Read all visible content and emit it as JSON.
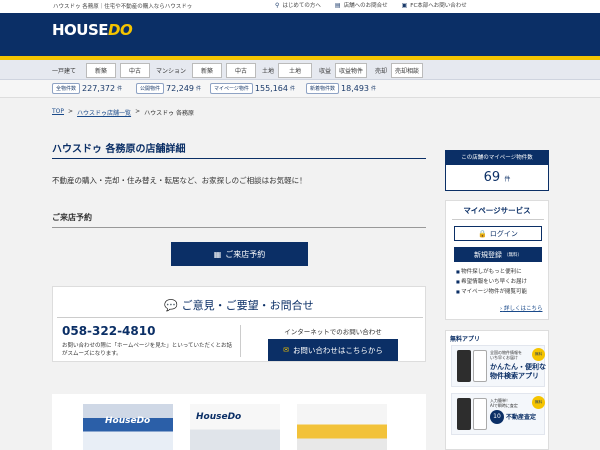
{
  "topbar": {
    "tagline": "ハウスドゥ 各務原｜住宅や不動産の購入ならハウスドゥ",
    "links": [
      {
        "icon": "map-pin-icon",
        "label": "はじめての方へ"
      },
      {
        "icon": "document-icon",
        "label": "店舗へのお問合せ"
      },
      {
        "icon": "building-icon",
        "label": "FC本部へお問い合わせ"
      }
    ]
  },
  "header": {
    "logo_house": "HOUSE",
    "logo_do": "DO"
  },
  "nav": {
    "groups": [
      {
        "category": "一戸建て",
        "buttons": [
          "新築",
          "中古"
        ]
      },
      {
        "category": "マンション",
        "buttons": [
          "新築",
          "中古"
        ]
      },
      {
        "category": "土地",
        "buttons": [
          "土地"
        ]
      },
      {
        "category": "収益",
        "buttons": [
          "収益物件"
        ]
      },
      {
        "category": "売却",
        "buttons": [
          "売却相談"
        ]
      }
    ]
  },
  "stats": [
    {
      "label": "全物件数",
      "value": "227,372",
      "unit": "件"
    },
    {
      "label": "公開物件",
      "value": "72,249",
      "unit": "件"
    },
    {
      "label": "マイページ物件",
      "value": "155,164",
      "unit": "件"
    },
    {
      "label": "新着物件数",
      "value": "18,493",
      "unit": "件"
    }
  ],
  "breadcrumb": {
    "top": "TOP",
    "sep1": ">",
    "list": "ハウスドゥ店舗一覧",
    "sep2": ">",
    "current": "ハウスドゥ 各務原"
  },
  "main": {
    "title": "ハウスドゥ 各務原の店舗詳細",
    "intro": "不動産の購入・売却・住み替え・転居など、お家探しのご相談はお気軽に！",
    "visit_heading": "ご来店予約",
    "visit_button": "ご来店予約",
    "contact": {
      "title": "ご意見・ご要望・お問合せ",
      "phone": "058-322-4810",
      "phone_note": "お問い合わせの際に「ホームページを見た」といっていただくとお話がスムーズになります。",
      "web_label": "インターネットでのお問い合わせ",
      "mail_button": "お問い合わせはこちらから"
    },
    "photo_logo": "HouseDo"
  },
  "sidebar": {
    "mypage_head": "この店舗のマイページ物件数",
    "mypage_count": "69",
    "mypage_unit": "件",
    "service_head": "マイページサービス",
    "login": "ログイン",
    "register": "新規登録",
    "register_free": "（無料）",
    "features": [
      "物件探しがもっと便利に",
      "希望情報をいち早くお届け",
      "マイページ物件が閲覧可能"
    ],
    "more": "詳しくはこちら",
    "app_head": "無料アプリ",
    "app1_small": "全国の物件情報を\nいち早くお届け",
    "app1_big": "かんたん・便利な\n物件検索アプリ",
    "app1_badge": "無料",
    "app2_small": "入力簡単！\nAIで瞬時に査定",
    "app2_ten": "10",
    "app2_big": "不動産査定",
    "app2_badge": "無料"
  },
  "colors": {
    "navy": "#0b2f66",
    "yellow": "#f5c400"
  }
}
